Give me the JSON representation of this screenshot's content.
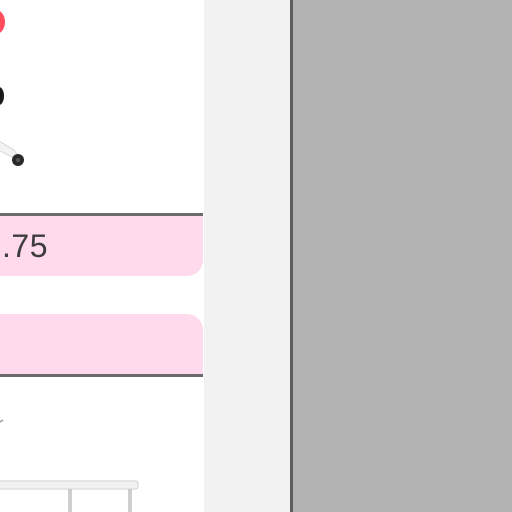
{
  "product_card": {
    "price_fragment": ".75",
    "product_image_icon": "office-chair-icon",
    "next_product_image_icon": "desk-icon"
  },
  "colors": {
    "price_band": "#ffd9ec",
    "rule": "#6a6a6a",
    "gutter": "#f2f2f2",
    "overlay": "#b3b3b3",
    "chair_accent": "#ff4d5e"
  }
}
